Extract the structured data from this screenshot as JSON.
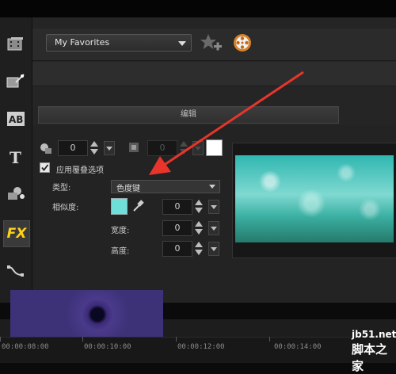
{
  "toolbar": {
    "favorites_label": "My Favorites",
    "icons": [
      "add-to-favorites-icon",
      "film-reel-icon"
    ]
  },
  "sidebar": {
    "items": [
      {
        "name": "media",
        "icon": "media-library-icon"
      },
      {
        "name": "instant-project",
        "icon": "instant-project-icon"
      },
      {
        "name": "transition",
        "icon": "transition-ab-icon"
      },
      {
        "name": "title",
        "icon": "title-t-icon"
      },
      {
        "name": "graphic",
        "icon": "graphic-icon"
      },
      {
        "name": "filter",
        "icon": "fx-icon",
        "label": "FX",
        "active": true
      },
      {
        "name": "path",
        "icon": "path-icon"
      }
    ]
  },
  "edit_panel": {
    "tab_label": "编辑",
    "border_width": "0",
    "shadow_value": "0",
    "overlay_checkbox_label": "应用覆叠选项",
    "overlay_checked": true,
    "type_label": "类型:",
    "type_value": "色度键",
    "similarity_label": "相似度:",
    "similarity_value": "0",
    "similarity_color": "#6fe0d9",
    "width_label": "宽度:",
    "width_value": "0",
    "height_label": "高度:",
    "height_value": "0"
  },
  "timeline": {
    "labels": [
      "00:00:08:00",
      "00:00:10:00",
      "00:00:12:00",
      "00:00:14:00"
    ]
  },
  "watermark": {
    "site": "jb51.net",
    "name": "脚本之家"
  },
  "colors": {
    "arrow": "#e8352b",
    "accent": "#6fe0d9"
  }
}
